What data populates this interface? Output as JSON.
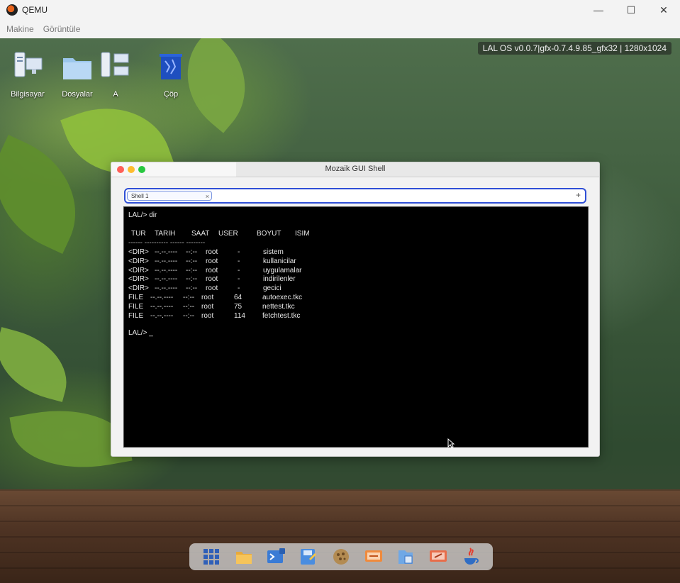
{
  "window": {
    "title": "QEMU",
    "controls": {
      "minimize": "—",
      "maximize": "☐",
      "close": "✕"
    }
  },
  "menu": [
    "Makine",
    "Görüntüle"
  ],
  "desktop": {
    "overlay": "LAL OS v0.0.7|gfx-0.7.4.9.85_gfx32 | 1280x1024",
    "icons": [
      {
        "label": "Bilgisayar",
        "icon": "computer-icon"
      },
      {
        "label": "Dosyalar",
        "icon": "folder-icon"
      },
      {
        "label": "A",
        "icon": "network-icon"
      },
      {
        "label": "Çöp",
        "icon": "trash-icon"
      }
    ]
  },
  "shell_window": {
    "title": "Mozaik GUI Shell",
    "tab_label": "Shell 1",
    "tab_close": "×",
    "tab_add": "+",
    "prompt_cmd": "LAL/> dir",
    "headers": {
      "tur": "TUR",
      "tarih": "TARIH",
      "saat": "SAAT",
      "user": "USER",
      "boyut": "BOYUT",
      "isim": "ISIM"
    },
    "separator": "------ ---------- ------ --------",
    "rows": [
      {
        "tur": "<DIR>",
        "tarih": "--.--.----",
        "saat": "--:--",
        "user": "root",
        "boyut": "-",
        "isim": "sistem"
      },
      {
        "tur": "<DIR>",
        "tarih": "--.--.----",
        "saat": "--:--",
        "user": "root",
        "boyut": "-",
        "isim": "kullanicilar"
      },
      {
        "tur": "<DIR>",
        "tarih": "--.--.----",
        "saat": "--:--",
        "user": "root",
        "boyut": "-",
        "isim": "uygulamalar"
      },
      {
        "tur": "<DIR>",
        "tarih": "--.--.----",
        "saat": "--:--",
        "user": "root",
        "boyut": "-",
        "isim": "indirilenler"
      },
      {
        "tur": "<DIR>",
        "tarih": "--.--.----",
        "saat": "--:--",
        "user": "root",
        "boyut": "-",
        "isim": "gecici"
      },
      {
        "tur": "FILE",
        "tarih": "--.--.----",
        "saat": "--:--",
        "user": "root",
        "boyut": "64",
        "isim": "autoexec.tkc"
      },
      {
        "tur": "FILE",
        "tarih": "--.--.----",
        "saat": "--:--",
        "user": "root",
        "boyut": "75",
        "isim": "nettest.tkc"
      },
      {
        "tur": "FILE",
        "tarih": "--.--.----",
        "saat": "--:--",
        "user": "root",
        "boyut": "114",
        "isim": "fetchtest.tkc"
      }
    ],
    "prompt_end": "LAL/> _"
  },
  "dock": [
    {
      "icon": "apps-grid-icon"
    },
    {
      "icon": "folder-icon"
    },
    {
      "icon": "terminal-icon"
    },
    {
      "icon": "save-editor-icon"
    },
    {
      "icon": "cookie-app-icon"
    },
    {
      "icon": "tools-icon"
    },
    {
      "icon": "file-manager-icon"
    },
    {
      "icon": "settings-tools-icon"
    },
    {
      "icon": "java-icon"
    }
  ]
}
